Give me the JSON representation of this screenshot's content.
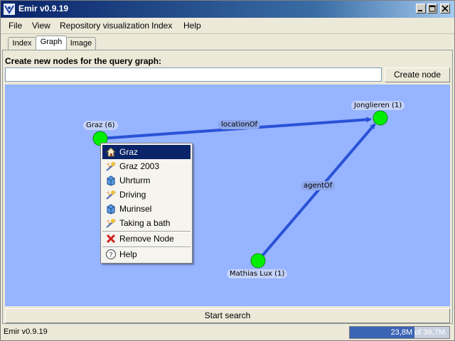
{
  "window": {
    "title": "Emir v0.9.19"
  },
  "menu": [
    "File",
    "View",
    "Repository visualization",
    "Index",
    "Help"
  ],
  "tabs": [
    {
      "label": "Index",
      "active": false
    },
    {
      "label": "Graph",
      "active": true
    },
    {
      "label": "Image",
      "active": false
    }
  ],
  "query": {
    "section_label": "Create new nodes for the query graph:",
    "input_value": "",
    "create_button": "Create node"
  },
  "graph": {
    "nodes": [
      {
        "id": "graz",
        "label": "Graz (6)",
        "color": "#00ee00"
      },
      {
        "id": "jonglieren",
        "label": "Jonglieren (1)",
        "color": "#00ee00"
      },
      {
        "id": "mathias",
        "label": "Mathias Lux (1)",
        "color": "#00ee00"
      }
    ],
    "edges": [
      {
        "from": "graz",
        "to": "jonglieren",
        "label": "locationOf",
        "color": "#2a52d6"
      },
      {
        "from": "mathias",
        "to": "jonglieren",
        "label": "agentOf",
        "color": "#2a52d6"
      }
    ],
    "background": "#96b4ff"
  },
  "context_menu": {
    "items": [
      {
        "label": "Graz",
        "icon": "home-icon",
        "selected": true
      },
      {
        "label": "Graz 2003",
        "icon": "event-icon",
        "selected": false
      },
      {
        "label": "Uhrturm",
        "icon": "object-icon",
        "selected": false
      },
      {
        "label": "Driving",
        "icon": "event-icon",
        "selected": false
      },
      {
        "label": "Murinsel",
        "icon": "object-icon",
        "selected": false
      },
      {
        "label": "Taking a bath",
        "icon": "event-icon",
        "selected": false
      }
    ],
    "remove_label": "Remove Node",
    "help_label": "Help"
  },
  "search_button": "Start search",
  "status": {
    "text": "Emir v0.9.19",
    "memory_text": "23,8M of 36,7M",
    "memory_fraction": 0.65
  },
  "colors": {
    "accent": "#0a246a",
    "node": "#00ee00",
    "edge": "#2a52d6"
  }
}
